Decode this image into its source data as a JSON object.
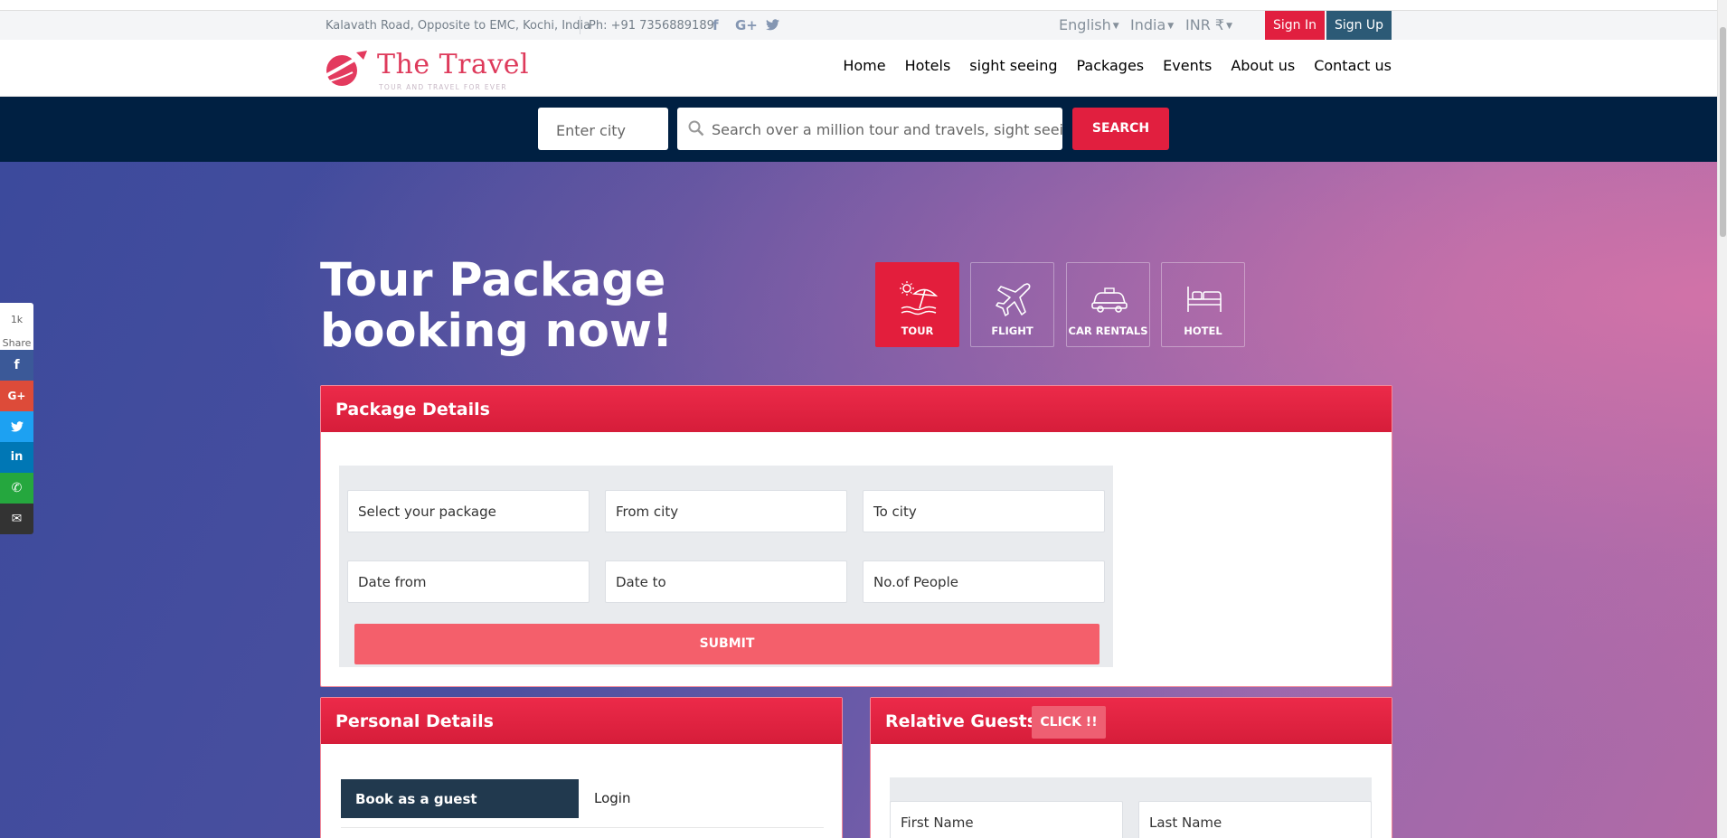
{
  "topbar": {
    "address": "Kalavath Road, Opposite to EMC, Kochi, India",
    "phone": "Ph: +91 7356889189",
    "social": [
      {
        "name": "facebook-icon",
        "glyph": "f"
      },
      {
        "name": "google-plus-icon",
        "glyph": "G+"
      },
      {
        "name": "twitter-icon",
        "glyph": "🐦"
      }
    ],
    "language": "English",
    "country": "India",
    "currency": "INR ₹",
    "signin": "Sign In",
    "signup": "Sign Up"
  },
  "header": {
    "brand": "The Travel",
    "tagline": "TOUR AND TRAVEL FOR EVER",
    "nav": [
      "Home",
      "Hotels",
      "sight seeing",
      "Packages",
      "Events",
      "About us",
      "Contact us"
    ]
  },
  "search": {
    "city_placeholder": "Enter city",
    "query_placeholder": "Search over a million tour and travels, sight seeings,...",
    "button": "SEARCH"
  },
  "hero": {
    "title": "Tour Package booking now!",
    "tiles": [
      {
        "label": "TOUR",
        "icon": "beach-umbrella-icon",
        "active": true
      },
      {
        "label": "FLIGHT",
        "icon": "airplane-icon",
        "active": false
      },
      {
        "label": "CAR RENTALS",
        "icon": "car-icon",
        "active": false
      },
      {
        "label": "HOTEL",
        "icon": "bed-icon",
        "active": false
      }
    ]
  },
  "package": {
    "title": "Package Details",
    "fields": {
      "package": "Select your package",
      "from_city": "From city",
      "to_city": "To city",
      "date_from": "Date from",
      "date_to": "Date to",
      "people": "No.of People"
    },
    "submit": "SUBMIT"
  },
  "personal": {
    "title": "Personal Details",
    "tab_guest": "Book as a guest",
    "tab_login": "Login"
  },
  "guests": {
    "title": "Relative Guests",
    "click": "CLICK !!",
    "first_name": "First Name",
    "last_name": "Last Name"
  },
  "share": {
    "count": "1k",
    "label": "Share",
    "buttons": [
      {
        "name": "facebook",
        "glyph": "f",
        "color": "#3b5998"
      },
      {
        "name": "google-plus",
        "glyph": "G+",
        "color": "#dd4b39"
      },
      {
        "name": "twitter",
        "glyph": "🐦",
        "color": "#1da1f2"
      },
      {
        "name": "linkedin",
        "glyph": "in",
        "color": "#0077b5"
      },
      {
        "name": "whatsapp",
        "glyph": "✆",
        "color": "#25a73e"
      },
      {
        "name": "email",
        "glyph": "✉",
        "color": "#333333"
      }
    ]
  },
  "colors": {
    "accent": "#e11f3f",
    "navy": "#002042",
    "signup": "#2c5a76",
    "submit": "#f45f6b"
  }
}
